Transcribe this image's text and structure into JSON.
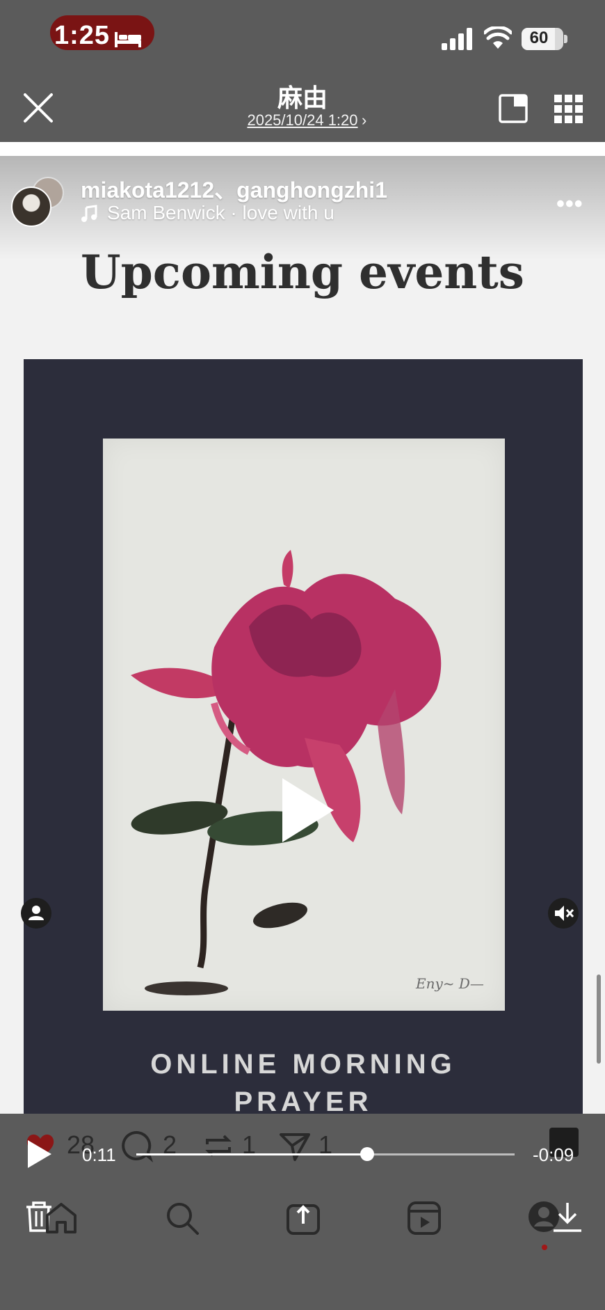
{
  "status_bar": {
    "time": "1:25",
    "battery": "60"
  },
  "header": {
    "title": "麻由",
    "subtitle": "2025/10/24 1:20"
  },
  "post": {
    "users": "miakota1212、ganghongzhi1",
    "music": "Sam Benwick · love with u",
    "heading": "Upcoming events",
    "poster_caption_line1": "ONLINE MORNING",
    "poster_caption_line2": "PRAYER"
  },
  "actions": {
    "likes": "28",
    "comments": "2",
    "reposts": "1",
    "shares": "1"
  },
  "player": {
    "elapsed": "0:11",
    "remaining": "-0:09",
    "progress": 0.61
  },
  "colors": {
    "accent_red": "#a01818",
    "status_pill": "#7a1414",
    "poster_bg": "#2c2d3b"
  },
  "icons": [
    "close-icon",
    "pip-icon",
    "grid-icon",
    "more-icon",
    "play-icon",
    "heart-icon",
    "comment-icon",
    "repost-icon",
    "send-icon",
    "trash-icon",
    "home-icon",
    "search-icon",
    "create-icon",
    "reels-icon",
    "profile-icon",
    "download-icon",
    "mute-icon",
    "user-tag-icon"
  ]
}
